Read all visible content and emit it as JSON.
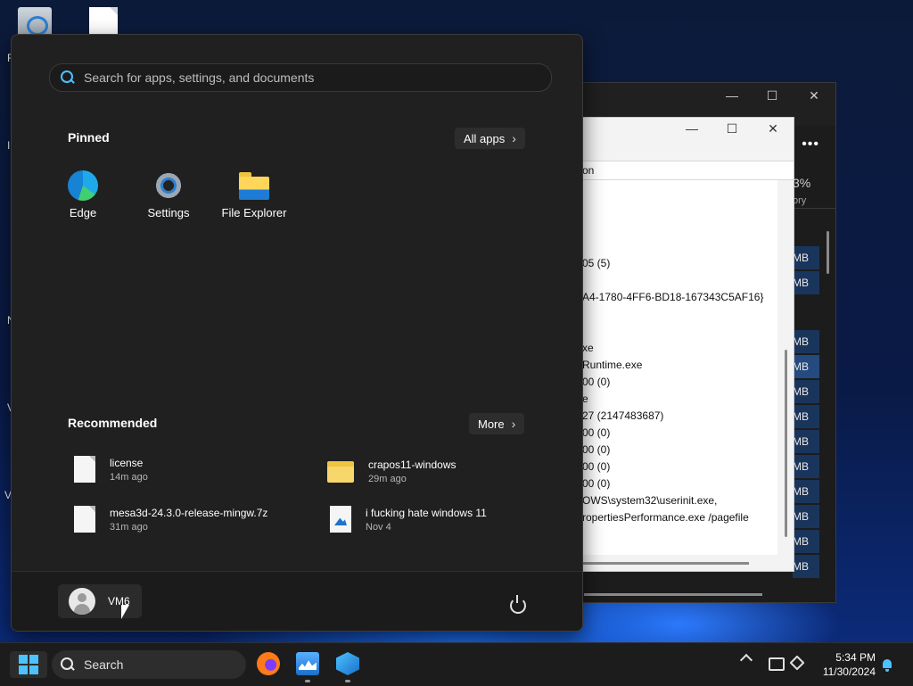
{
  "start_menu": {
    "search_placeholder": "Search for apps, settings, and documents",
    "pinned_title": "Pinned",
    "all_apps_label": "All apps",
    "pinned": [
      {
        "label": "Edge",
        "icon": "edge-icon"
      },
      {
        "label": "Settings",
        "icon": "settings-gear-icon"
      },
      {
        "label": "File Explorer",
        "icon": "folder-icon"
      }
    ],
    "recommended_title": "Recommended",
    "more_label": "More",
    "recommended": [
      {
        "name": "license",
        "time": "14m ago",
        "icon": "document-icon"
      },
      {
        "name": "crapos11-windows",
        "time": "29m ago",
        "icon": "zip-folder-icon"
      },
      {
        "name": "mesa3d-24.3.0-release-mingw.7z",
        "time": "31m ago",
        "icon": "document-icon"
      },
      {
        "name": "i fucking hate windows 11",
        "time": "Nov 4",
        "icon": "image-file-icon"
      }
    ],
    "user_name": "VM6"
  },
  "background_window": {
    "percent": "3%",
    "percent_label": "ory",
    "mb_unit": "MB",
    "properties_lines": [
      "on",
      "05 (5)",
      "A4-1780-4FF6-BD18-167343C5AF16}",
      "xe",
      "Runtime.exe",
      "00 (0)",
      "e",
      "27 (2147483687)",
      "00 (0)",
      "00 (0)",
      "00 (0)",
      "00 (0)",
      "OWS\\system32\\userinit.exe,",
      "ropertiesPerformance.exe /pagefile"
    ]
  },
  "taskbar": {
    "search_label": "Search",
    "time": "5:34 PM",
    "date": "11/30/2024"
  },
  "accent_color": "#4cc2ff"
}
